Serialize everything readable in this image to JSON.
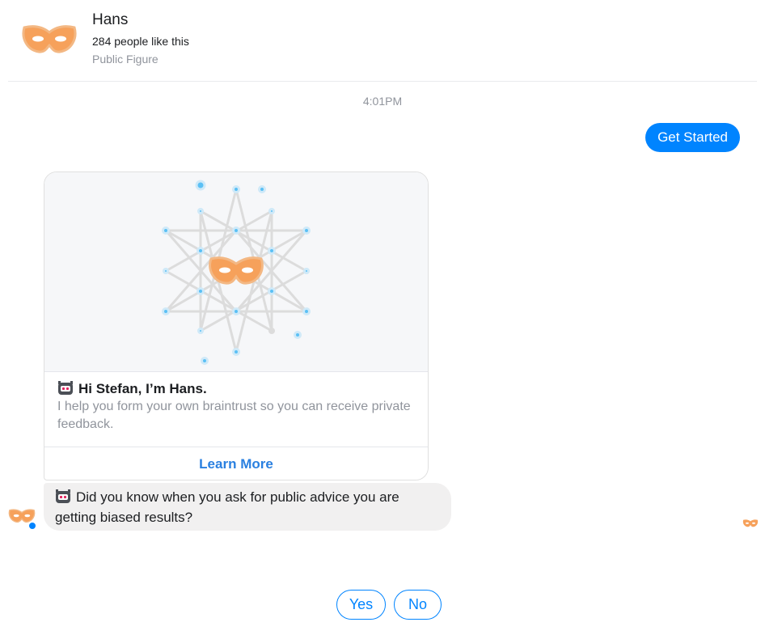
{
  "header": {
    "name": "Hans",
    "likes": "284 people like this",
    "category": "Public Figure"
  },
  "conversation": {
    "timestamp": "4:01PM",
    "outgoing_message": "Get Started",
    "card": {
      "title": "Hi Stefan, I’m Hans.",
      "subtitle": "I help you form your own braintrust so you can receive private feedback.",
      "button_label": "Learn More"
    },
    "incoming_message": "Did you know when you ask for public advice you are getting biased results?",
    "quick_replies": [
      "Yes",
      "No"
    ]
  },
  "colors": {
    "accent": "#0084ff",
    "mask_orange": "#f6a15b",
    "node_blue": "#5bc0f5",
    "bubble_gray": "#f1f0f0"
  },
  "icons": {
    "avatar": "orange-mask-icon",
    "emoji": "robot-face-icon",
    "badge": "messenger-badge-icon"
  }
}
